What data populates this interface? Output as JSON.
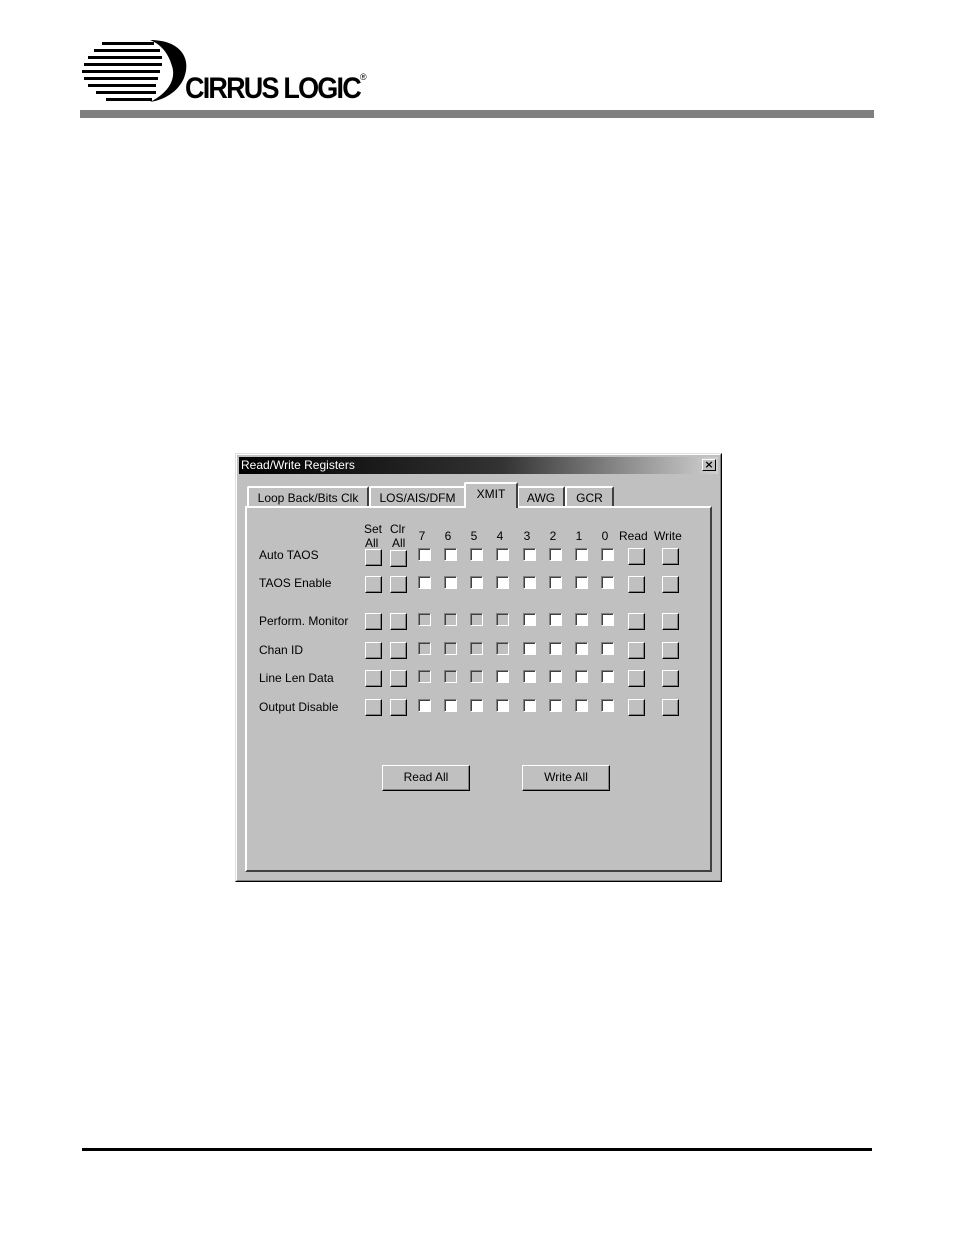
{
  "brand": {
    "name": "CIRRUS LOGIC",
    "reg_mark": "®"
  },
  "dialog": {
    "title": "Read/Write Registers",
    "close_glyph": "×",
    "tabs": [
      {
        "label": "Loop Back/Bits Clk",
        "active": false
      },
      {
        "label": "LOS/AIS/DFM",
        "active": false
      },
      {
        "label": "XMIT",
        "active": true
      },
      {
        "label": "AWG",
        "active": false
      },
      {
        "label": "GCR",
        "active": false
      }
    ],
    "columns": {
      "set_all": [
        "Set",
        "All"
      ],
      "clr_all": [
        "Clr",
        "All"
      ],
      "bits": [
        "7",
        "6",
        "5",
        "4",
        "3",
        "2",
        "1",
        "0"
      ],
      "read": "Read",
      "write": "Write"
    },
    "rows": [
      {
        "label": "Auto TAOS",
        "bit_enabled": [
          true,
          true,
          true,
          true,
          true,
          true,
          true,
          true
        ]
      },
      {
        "label": "TAOS Enable",
        "bit_enabled": [
          true,
          true,
          true,
          true,
          true,
          true,
          true,
          true
        ]
      },
      {
        "label": "Perform. Monitor",
        "bit_enabled": [
          false,
          false,
          false,
          false,
          true,
          true,
          true,
          true
        ]
      },
      {
        "label": "Chan ID",
        "bit_enabled": [
          false,
          false,
          false,
          false,
          true,
          true,
          true,
          true
        ]
      },
      {
        "label": "Line Len Data",
        "bit_enabled": [
          false,
          false,
          false,
          true,
          true,
          true,
          true,
          true
        ]
      },
      {
        "label": "Output Disable",
        "bit_enabled": [
          true,
          true,
          true,
          true,
          true,
          true,
          true,
          true
        ]
      }
    ],
    "buttons": {
      "read_all": "Read All",
      "write_all": "Write All"
    }
  }
}
